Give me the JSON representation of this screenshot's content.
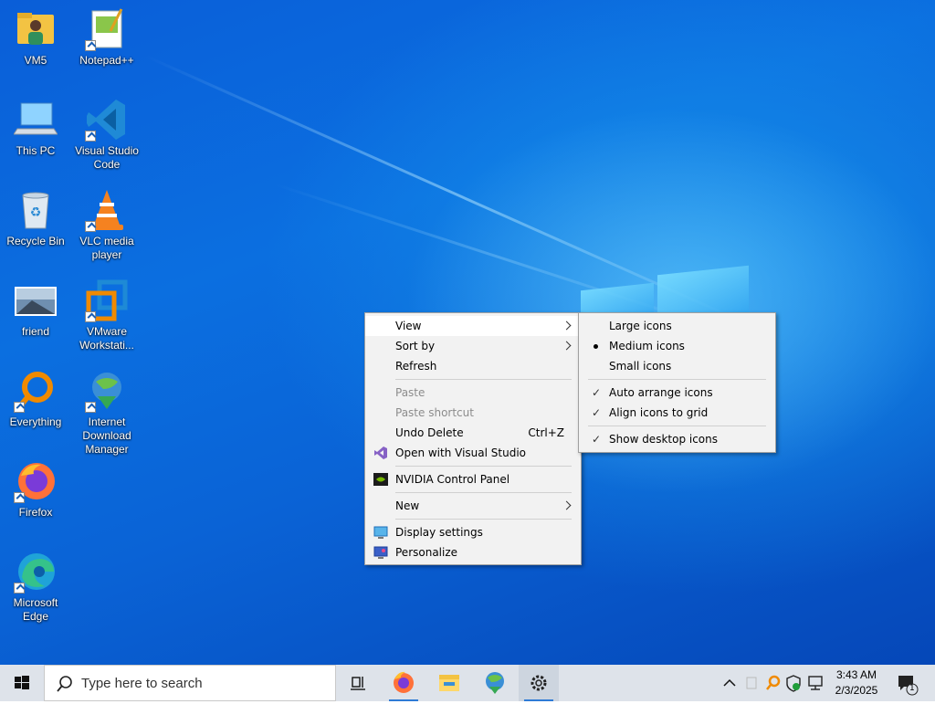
{
  "desktop_icons": [
    {
      "label": "VM5",
      "icon": "user-folder-icon"
    },
    {
      "label": "Notepad++",
      "icon": "notepadpp-icon"
    },
    {
      "label": "This PC",
      "icon": "computer-icon"
    },
    {
      "label": "Visual Studio Code",
      "icon": "vscode-icon"
    },
    {
      "label": "Recycle Bin",
      "icon": "recycle-bin-icon"
    },
    {
      "label": "VLC media player",
      "icon": "vlc-icon"
    },
    {
      "label": "friend",
      "icon": "image-file-icon"
    },
    {
      "label": "VMware Workstati...",
      "icon": "vmware-icon"
    },
    {
      "label": "Everything",
      "icon": "everything-search-icon"
    },
    {
      "label": "Internet Download Manager",
      "icon": "idm-icon"
    },
    {
      "label": "Firefox",
      "icon": "firefox-icon"
    },
    {
      "label": "Microsoft Edge",
      "icon": "edge-icon"
    }
  ],
  "context_menu": {
    "view": "View",
    "sort_by": "Sort by",
    "refresh": "Refresh",
    "paste": "Paste",
    "paste_shortcut": "Paste shortcut",
    "undo_delete": "Undo Delete",
    "undo_shortcut": "Ctrl+Z",
    "open_vs": "Open with Visual Studio",
    "nvidia": "NVIDIA Control Panel",
    "new": "New",
    "display_settings": "Display settings",
    "personalize": "Personalize"
  },
  "view_submenu": {
    "large_icons": "Large icons",
    "medium_icons": "Medium icons",
    "small_icons": "Small icons",
    "auto_arrange": "Auto arrange icons",
    "align_grid": "Align icons to grid",
    "show_desktop_icons": "Show desktop icons",
    "selected_size": "Medium icons",
    "checked": [
      "Auto arrange icons",
      "Align icons to grid",
      "Show desktop icons"
    ]
  },
  "taskbar": {
    "search_placeholder": "Type here to search",
    "pinned": [
      "task-view-icon",
      "firefox-icon",
      "file-explorer-icon",
      "idm-icon",
      "settings-icon"
    ],
    "time": "3:43 AM",
    "date": "2/3/2025",
    "notification_count": "1"
  },
  "colors": {
    "desktop_blue": "#0a63d6",
    "taskbar": "#dee3ea",
    "menu_bg": "#f2f2f2",
    "accent": "#2e7bd6"
  }
}
